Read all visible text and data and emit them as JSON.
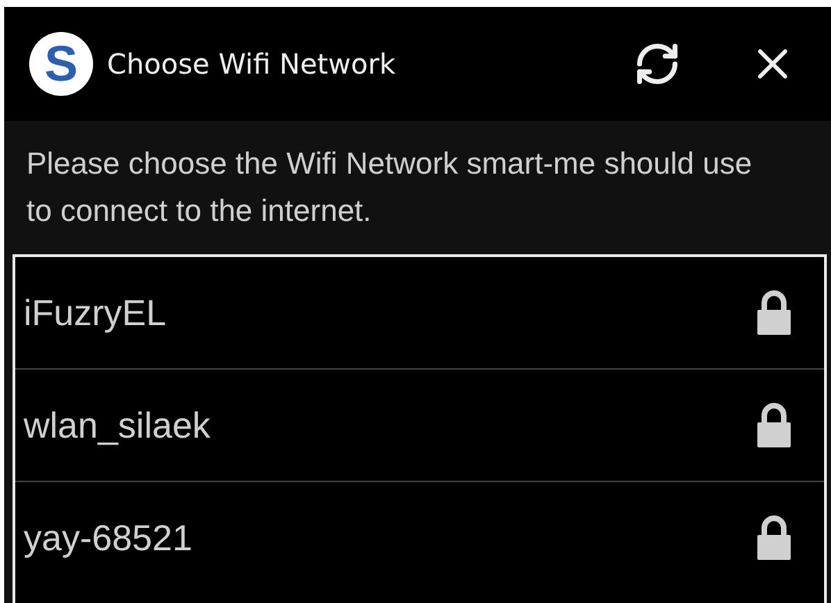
{
  "dialog": {
    "title": "Choose Wifi Network",
    "app_logo_letter": "S"
  },
  "description": "Please choose the Wifi Network smart-me should use to connect to the internet.",
  "networks": [
    {
      "name": "iFuzryEL",
      "secured": true
    },
    {
      "name": "wlan_silaek",
      "secured": true
    },
    {
      "name": "yay-68521",
      "secured": true
    }
  ]
}
